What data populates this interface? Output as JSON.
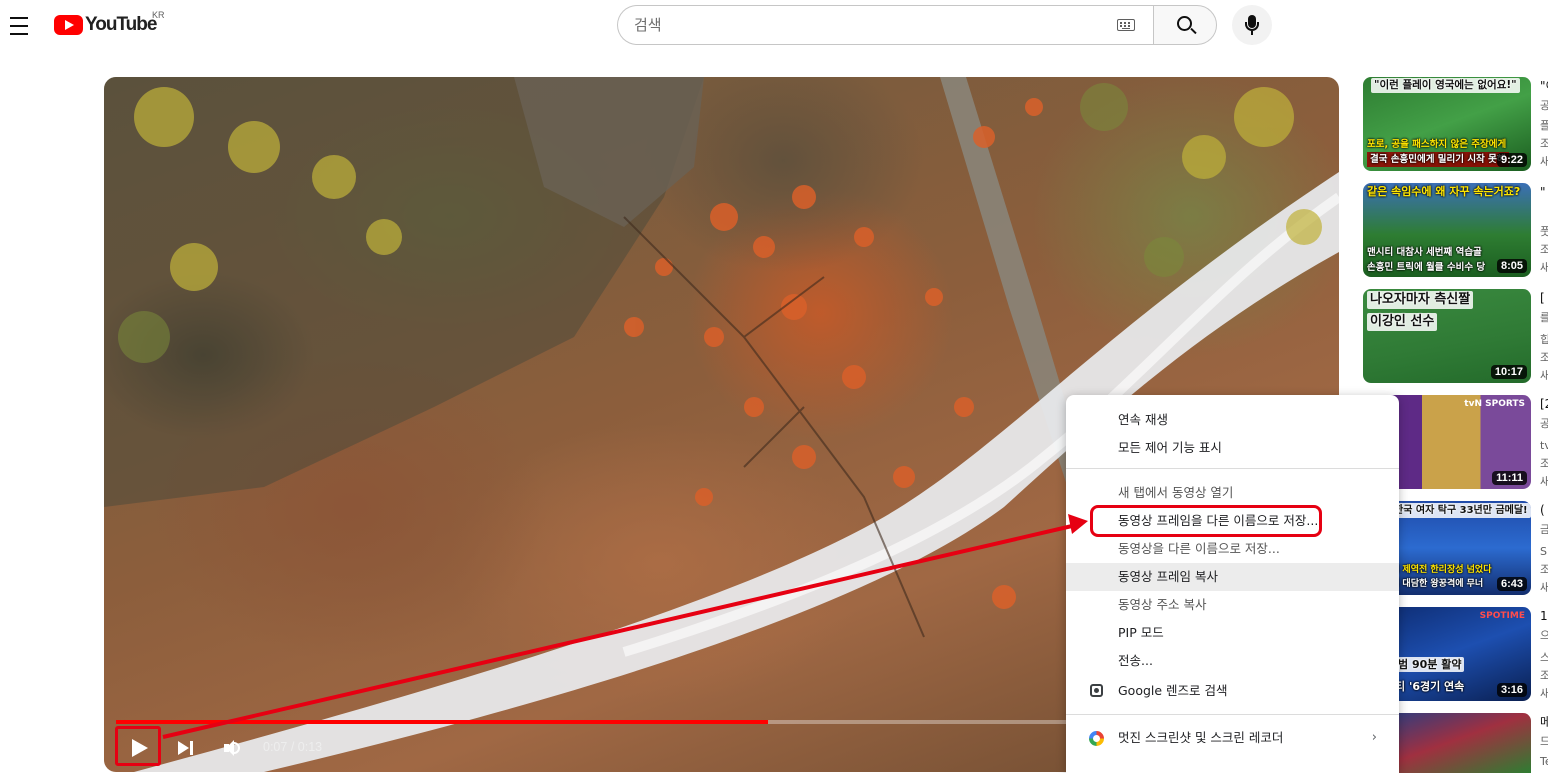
{
  "header": {
    "logo_text": "YouTube",
    "region": "KR",
    "search_placeholder": "검색"
  },
  "player": {
    "time_current": "0:07",
    "time_total": "0:13",
    "time_separator": " / ",
    "progress_fraction": 0.5385
  },
  "context_menu": {
    "items": [
      "연속 재생",
      "모든 제어 기능 표시",
      "새 탭에서 동영상 열기",
      "동영상 프레임을 다른 이름으로 저장...",
      "동영상을 다른 이름으로 저장...",
      "동영상 프레임 복사",
      "동영상 주소 복사",
      "PIP 모드",
      "전송...",
      "Google 렌즈로 검색",
      "멋진 스크린샷 및 스크린 레코더"
    ],
    "submenu_arrow": "›"
  },
  "sidebar": {
    "videos": [
      {
        "captions": [
          "\"이런 플레이 영국에는 없어요!\"",
          "포로, 공을 패스하지 않은 주장에게",
          "결국 손흥민에게 밀리기 시작 못해"
        ],
        "duration": "9:22",
        "title_fragment": "\"이",
        "meta": [
          "공",
          "플",
          "조",
          "새"
        ]
      },
      {
        "captions": [
          "같은 속임수에 왜 자꾸 속는거죠?",
          "맨시티 대참사 세번째 역습골",
          "손흥민 트릭에 월클 수비수 당"
        ],
        "duration": "8:05",
        "title_fragment": "\"",
        "meta": [
          "",
          "풋",
          "조",
          "새"
        ]
      },
      {
        "captions": [
          "나오자마자 측신짤",
          "이강인 선수"
        ],
        "duration": "10:17",
        "title_fragment": "[",
        "meta": [
          "를",
          "힙",
          "조",
          "새"
        ]
      },
      {
        "captions": [
          "tvN SPORTS"
        ],
        "duration": "11:11",
        "title_fragment": "[2",
        "meta": [
          "공",
          "tv",
          "조",
          "새"
        ]
      },
      {
        "captions": [
          "한국 여자 탁구 33년만 금메달!",
          "에 제역전 한리장성 넘었다",
          "의 대담한 왕꿍격에 무너"
        ],
        "duration": "6:43",
        "title_fragment": "(",
        "meta": [
          "금",
          "SI",
          "조",
          "새"
        ]
      },
      {
        "captions": [
          "SPOTIME",
          "범 90분 활약",
          "티 '6경기 연속"
        ],
        "duration": "3:16",
        "title_fragment": "1",
        "meta": [
          "으",
          "스",
          "조",
          "새"
        ]
      },
      {
        "captions": [],
        "duration": "",
        "title_fragment": "메",
        "meta": [
          "드",
          "Te"
        ]
      }
    ]
  },
  "colors": {
    "brand_red": "#ff0000",
    "annotation_red": "#e60012",
    "progress_red": "#ff0000"
  }
}
